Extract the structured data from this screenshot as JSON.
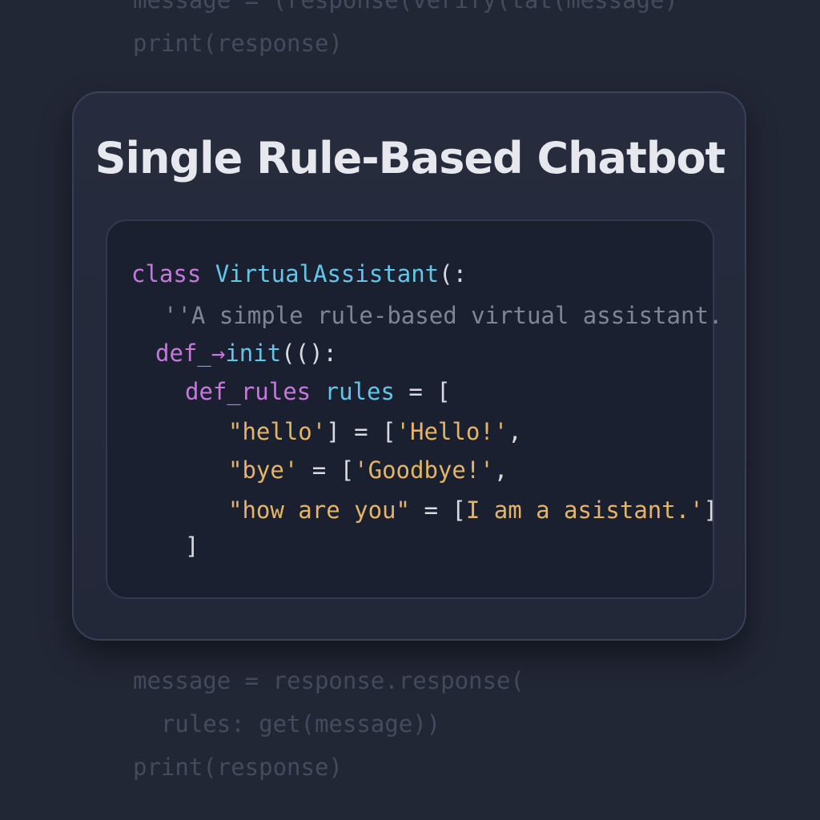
{
  "background_code": {
    "top_cut_line": "message = (response(verify(tat(message)",
    "top_line": "print(response)",
    "bottom_lines": [
      "message = response.response(",
      "  rules: get(message))",
      "print(response)"
    ]
  },
  "card": {
    "title": "Single Rule-Based Chatbot"
  },
  "code": {
    "line1": {
      "keyword": "class",
      "name": "VirtualAssistant",
      "suffix": "(:"
    },
    "line2": {
      "docstring": "''A simple rule-based virtual assistant."
    },
    "line3": {
      "keyword": "def",
      "connector": "_→",
      "name": "init",
      "suffix": "(():"
    },
    "line4": {
      "keyword": "def_rules",
      "name": "rules",
      "suffix": " = ["
    },
    "line5": {
      "key": "\"hello'",
      "middle": "] = [",
      "value": "'Hello!'",
      "suffix": ","
    },
    "line6": {
      "key": "\"bye'",
      "middle": " = [",
      "value": "'Goodbye!'",
      "suffix": ","
    },
    "line7": {
      "key": "\"how are you\"",
      "middle": " = [",
      "value": "I am a asistant.'",
      "suffix": "]"
    },
    "line8": {
      "closing": "]"
    }
  },
  "colors": {
    "background": "#222736",
    "keyword": "#c678dd",
    "identifier": "#61c6e8",
    "string": "#e5b567",
    "docstring": "#7f8595",
    "title": "#e6e8ee"
  }
}
